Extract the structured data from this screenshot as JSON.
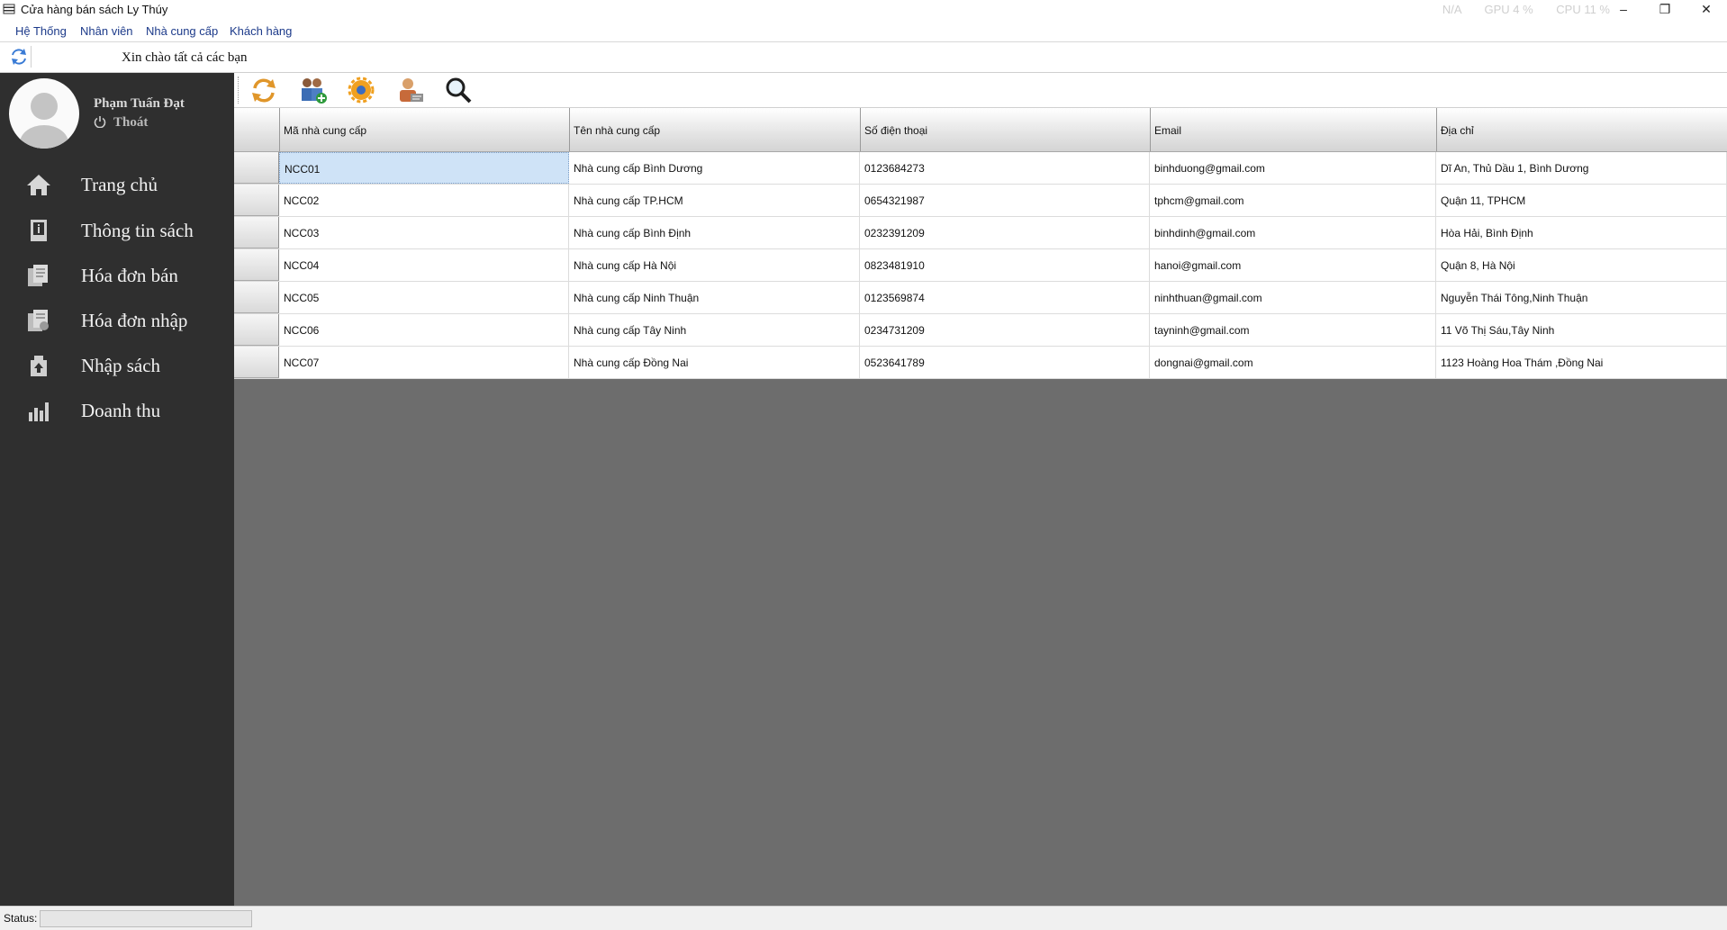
{
  "window": {
    "title": "Cửa hàng bán sách Ly Thúy",
    "stats": [
      "N/A",
      "GPU  4 %",
      "CPU  11 %"
    ],
    "minimize_glyph": "–",
    "restore_glyph": "❐",
    "close_glyph": "✕"
  },
  "menu": [
    "Hệ Thống",
    "Nhân viên",
    "Nhà cung cấp",
    "Khách hàng"
  ],
  "greeting": "Xin chào tất cả các bạn",
  "user": {
    "name": "Phạm Tuấn Đạt",
    "logout": "Thoát"
  },
  "nav": [
    {
      "label": "Trang chủ",
      "icon": "home-icon"
    },
    {
      "label": "Thông tin sách",
      "icon": "book-info-icon"
    },
    {
      "label": "Hóa đơn bán",
      "icon": "sales-invoice-icon"
    },
    {
      "label": "Hóa đơn nhập",
      "icon": "import-invoice-icon"
    },
    {
      "label": "Nhập sách",
      "icon": "import-book-icon"
    },
    {
      "label": "Doanh thu",
      "icon": "revenue-chart-icon"
    }
  ],
  "toolbar": [
    "refresh-icon",
    "add-supplier-icon",
    "settings-gear-icon",
    "edit-user-icon",
    "search-icon"
  ],
  "grid": {
    "columns": [
      "Mã nhà cung cấp",
      "Tên nhà cung cấp",
      "Số điện thoại",
      "Email",
      "Địa chỉ"
    ],
    "rows": [
      [
        "NCC01",
        "Nhà cung cấp Bình Dương",
        "0123684273",
        "binhduong@gmail.com",
        "Dĩ An, Thủ Dầu 1, Bình Dương"
      ],
      [
        "NCC02",
        "Nhà cung cấp TP.HCM",
        "0654321987",
        "tphcm@gmail.com",
        "Quận 11, TPHCM"
      ],
      [
        "NCC03",
        "Nhà cung cấp Bình Định",
        "0232391209",
        "binhdinh@gmail.com",
        "Hòa Hải, Bình Định"
      ],
      [
        "NCC04",
        "Nhà cung cấp Hà Nội",
        "0823481910",
        "hanoi@gmail.com",
        "Quận 8, Hà Nội"
      ],
      [
        "NCC05",
        "Nhà cung cấp Ninh Thuận",
        "0123569874",
        "ninhthuan@gmail.com",
        "Nguyễn Thái Tông,Ninh Thuận"
      ],
      [
        "NCC06",
        "Nhà cung cấp Tây Ninh",
        "0234731209",
        "tayninh@gmail.com",
        "11 Võ Thị Sáu,Tây Ninh"
      ],
      [
        "NCC07",
        "Nhà cung cấp Đồng Nai",
        "0523641789",
        "dongnai@gmail.com",
        "1123 Hoàng Hoa Thám ,Đồng Nai"
      ]
    ]
  },
  "status": {
    "label": "Status:"
  }
}
